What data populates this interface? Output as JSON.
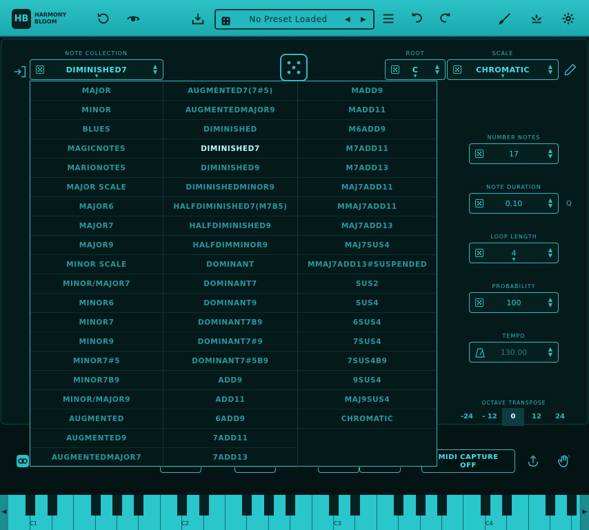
{
  "header": {
    "logo_mark": "HB",
    "logo_line1": "HARMONY",
    "logo_line2": "BLOOM",
    "preset_name": "No Preset Loaded",
    "prev_arrow": "◀",
    "next_arrow": "▶"
  },
  "controls": {
    "note_collection_label": "NOTE COLLECTION",
    "note_collection_value": "DIMINISHED7",
    "root_label": "ROOT",
    "root_value": "C",
    "scale_label": "SCALE",
    "scale_value": "CHROMATIC",
    "number_notes_label": "NUMBER NOTES",
    "number_notes_value": "17",
    "note_duration_label": "NOTE DURATION",
    "note_duration_value": "0.10",
    "note_duration_unit": "Q",
    "loop_length_label": "LOOP LENGTH",
    "loop_length_value": "4",
    "probability_label": "PROBABILITY",
    "probability_value": "100",
    "tempo_label": "TEMPO",
    "tempo_value": "130.00",
    "octave_transpose_label": "OCTAVE TRANSPOSE",
    "octave_options": [
      "-24",
      "- 12",
      "0",
      "12",
      "24"
    ],
    "octave_selected": "0"
  },
  "dropdown": {
    "col1": [
      "MAJOR",
      "MINOR",
      "BLUES",
      "MAGICNOTES",
      "MARIONOTES",
      "MAJOR SCALE",
      "MAJOR6",
      "MAJOR7",
      "MAJOR9",
      "MINOR SCALE",
      "MINOR/MAJOR7",
      "MINOR6",
      "MINOR7",
      "MINOR9",
      "MINOR7#5",
      "MINOR7B9",
      "MINOR/MAJOR9",
      "AUGMENTED",
      "AUGMENTED9",
      "AUGMENTEDMAJOR7"
    ],
    "col2": [
      "AUGMENTED7(7#5)",
      "AUGMENTEDMAJOR9",
      "DIMINISHED",
      "DIMINISHED7",
      "DIMINISHED9",
      "DIMINISHEDMINOR9",
      "HALFDIMINISHED7(M7B5)",
      "HALFDIMINISHED9",
      "HALFDIMMINOR9",
      "DOMINANT",
      "DOMINANT7",
      "DOMINANT9",
      "DOMINANT7B9",
      "DOMINANT7#9",
      "DOMINANT7#5B9",
      "ADD9",
      "ADD11",
      "6ADD9",
      "7ADD11",
      "7ADD13"
    ],
    "col3": [
      "MADD9",
      "MADD11",
      "M6ADD9",
      "M7ADD11",
      "M7ADD13",
      "MAJ7ADD11",
      "MMAJ7ADD11",
      "MAJ7ADD13",
      "MAJ7SUS4",
      "MMAJ7ADD13#SUSPENDED",
      "SUS2",
      "SUS4",
      "6SUS4",
      "7SUS4",
      "7SUS4B9",
      "9SUS4",
      "MAJ9SUS4",
      "CHROMATIC"
    ],
    "selected": "DIMINISHED7"
  },
  "bottom": {
    "midi_capture_line1": "MIDI CAPTURE",
    "midi_capture_line2": "OFF"
  },
  "keyboard": {
    "octave_labels": [
      "C1",
      "C2",
      "C3",
      "C4"
    ]
  },
  "colors": {
    "accent": "#2fbcc2",
    "accent_bright": "#3fe3e8",
    "background": "#051a1b",
    "topbar": "#22b8bc"
  }
}
